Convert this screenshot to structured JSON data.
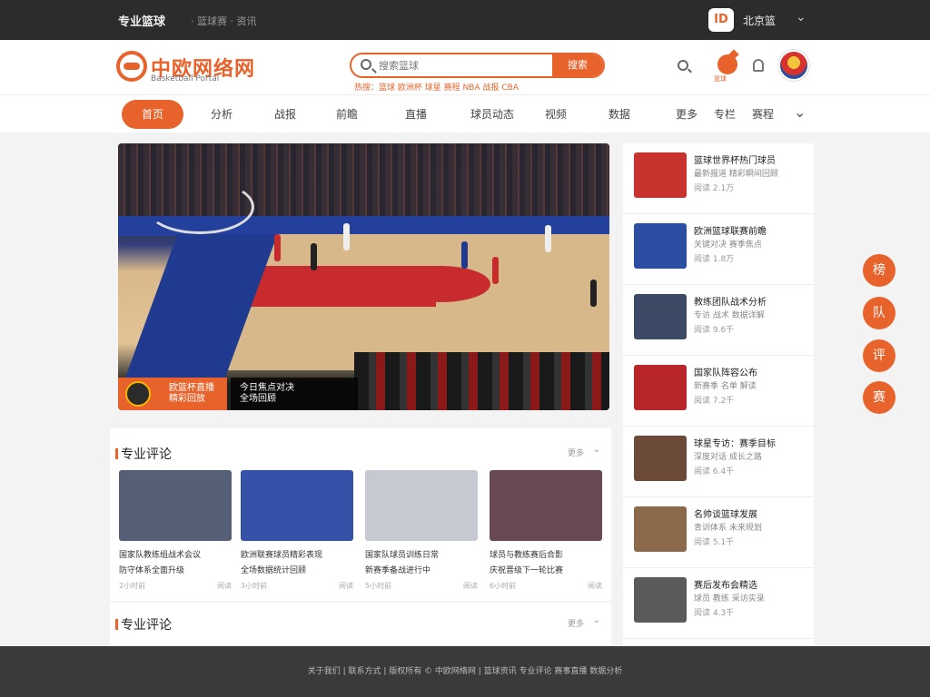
{
  "topbar": {
    "brand": "专业篮球",
    "links": "· 篮球赛 · 资讯",
    "user_badge": "ID",
    "user_name": "北京篮"
  },
  "header": {
    "logo_text": "中欧网络网",
    "logo_sub": "Basketball Portal",
    "search_placeholder": "搜索篮球",
    "search_button": "搜索",
    "hot_words": "热搜：篮球 欧洲杯 球星 赛程 NBA 战报 CBA",
    "ball_label": "篮球"
  },
  "nav": {
    "active": "首页",
    "items": [
      "分析",
      "战报",
      "前瞻",
      "直播",
      "球员动态",
      "视频",
      "数据",
      "更多",
      "专栏",
      "赛程"
    ]
  },
  "hero": {
    "caption_left_1": "欧篮杯直播",
    "caption_left_2": "精彩回放",
    "caption_mid_1": "今日焦点对决",
    "caption_mid_2": "全场回顾"
  },
  "sidebar": {
    "items": [
      {
        "t1": "篮球世界杯热门球员",
        "t2": "最新报道 精彩瞬间回顾",
        "t3": "阅读 2.1万",
        "thumb": "#c9332f"
      },
      {
        "t1": "欧洲篮球联赛前瞻",
        "t2": "关键对决 赛季焦点",
        "t3": "阅读 1.8万",
        "thumb": "#2b4ea3"
      },
      {
        "t1": "教练团队战术分析",
        "t2": "专访 战术 数据详解",
        "t3": "阅读 9.6千",
        "thumb": "#3d4a66"
      },
      {
        "t1": "国家队阵容公布",
        "t2": "新赛季 名单 解读",
        "t3": "阅读 7.2千",
        "thumb": "#b8262a"
      },
      {
        "t1": "球星专访：赛季目标",
        "t2": "深度对话 成长之路",
        "t3": "阅读 6.4千",
        "thumb": "#6b4a3a"
      },
      {
        "t1": "名帅谈篮球发展",
        "t2": "青训体系 未来规划",
        "t3": "阅读 5.1千",
        "thumb": "#8a6a4a"
      },
      {
        "t1": "赛后发布会精选",
        "t2": "球员 教练 采访实录",
        "t3": "阅读 4.3千",
        "thumb": "#5a5a5a"
      }
    ]
  },
  "float": [
    "榜",
    "队",
    "评",
    "赛"
  ],
  "section1": {
    "title": "专业评论",
    "more": "更多",
    "cards": [
      {
        "c1": "国家队教练组战术会议",
        "c2": "防守体系全面升级",
        "time": "2小时前",
        "views": "阅读",
        "img": "#556077"
      },
      {
        "c1": "欧洲联赛球员精彩表现",
        "c2": "全场数据统计回顾",
        "time": "3小时前",
        "views": "阅读",
        "img": "#3552a8"
      },
      {
        "c1": "国家队球员训练日常",
        "c2": "新赛季备战进行中",
        "time": "5小时前",
        "views": "阅读",
        "img": "#c7c9d2"
      },
      {
        "c1": "球员与教练赛后合影",
        "c2": "庆祝晋级下一轮比赛",
        "time": "6小时前",
        "views": "阅读",
        "img": "#6a4a52"
      }
    ]
  },
  "section2": {
    "title": "专业评论",
    "more": "更多"
  },
  "footer": {
    "text": "关于我们 | 联系方式 | 版权所有 © 中欧网络网 | 篮球资讯 专业评论 赛事直播 数据分析"
  }
}
